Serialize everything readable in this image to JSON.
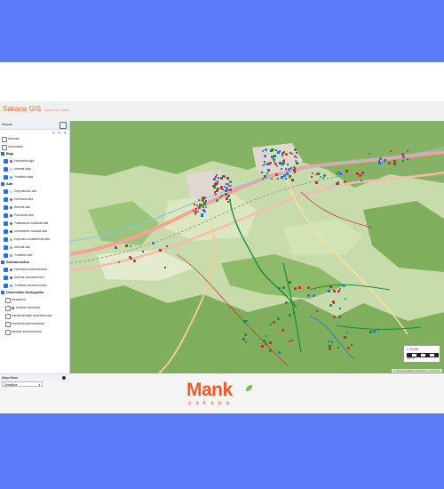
{
  "app": {
    "title": "Sakana GIS",
    "subtitle": "Sakanako Udala"
  },
  "sidebar": {
    "header": "Mapas",
    "top_items": [
      {
        "label": "Alarmak",
        "checked": false
      },
      {
        "label": "Azeredidak",
        "checked": false
      }
    ],
    "groups": [
      {
        "title": "Baja",
        "items": [
          {
            "label": "Hornitaria baja",
            "checked": true,
            "color": "#e23a3a"
          },
          {
            "label": "Arbelak baja",
            "checked": true,
            "color": "#f2b6d2"
          },
          {
            "label": "Ynsiltaria baja",
            "checked": true,
            "color": "#5aa9e6"
          }
        ]
      },
      {
        "title": "Alta",
        "items": [
          {
            "label": "Depositukak alta",
            "checked": true,
            "color": "#b8d9f0"
          },
          {
            "label": "Hornitaria alta",
            "checked": true,
            "color": "#e23a3a"
          },
          {
            "label": "Arbelak alta",
            "checked": true,
            "color": "#2f7ec2"
          },
          {
            "label": "Putzuketa alta",
            "checked": true,
            "color": "#2e7d32"
          },
          {
            "label": "Tratamendu ostatuak alta",
            "checked": true,
            "color": "#e23a3a"
          },
          {
            "label": "Ureztatzeko kanalak alta",
            "checked": true,
            "color": "#1a6e2a"
          },
          {
            "label": "Depositu konbatimnak alta",
            "checked": true,
            "color": "#8bc34a"
          },
          {
            "label": "Arbelak alta",
            "checked": true,
            "color": "#e28b3a"
          },
          {
            "label": "Ynsiltaria alta",
            "checked": true,
            "color": "#5aa9e6"
          }
        ]
      },
      {
        "title": "Saneamendua",
        "items": [
          {
            "label": "Hornitaria saneamendua",
            "checked": true,
            "color": "#8e44ad"
          },
          {
            "label": "Arbelak saneamendua",
            "checked": true,
            "color": "#2e7d32"
          },
          {
            "label": "Ynsiltaria saneamendua",
            "checked": true,
            "color": "#5aa9e6"
          }
        ]
      }
    ],
    "extra_group": "Dimentsiko Kartografia",
    "extra_items": [
      {
        "label": "Akasahina",
        "checked": false,
        "color": ""
      },
      {
        "label": "Kaldeiro arbelinak",
        "checked": false,
        "color": "#e23a3a"
      },
      {
        "label": "Nardarratzialak saneamendua",
        "checked": false,
        "color": ""
      },
      {
        "label": "Hornitaria saneamendua",
        "checked": false,
        "color": ""
      },
      {
        "label": "Arbelak saneamendua",
        "checked": false,
        "color": ""
      }
    ],
    "toolbar_glyphs": "✎ ✎ ✕"
  },
  "basemap": {
    "header": "Mapa Base",
    "selected": "Ortofotoa",
    "arrow": "▾"
  },
  "map": {
    "scale_text": "1: 25.000",
    "scale_distance": "500 m",
    "attribution": "© OpenStreetMap contributors, CC-BY-SA",
    "colors": {
      "forest": "#7fae5d",
      "field": "#cde0ac",
      "road": "#f4a19a",
      "network_green": "#1b8a3a",
      "network_red": "#d62828",
      "network_blue": "#2a6fd6"
    }
  },
  "logo": {
    "word": "Mank",
    "sub": "sakana"
  }
}
